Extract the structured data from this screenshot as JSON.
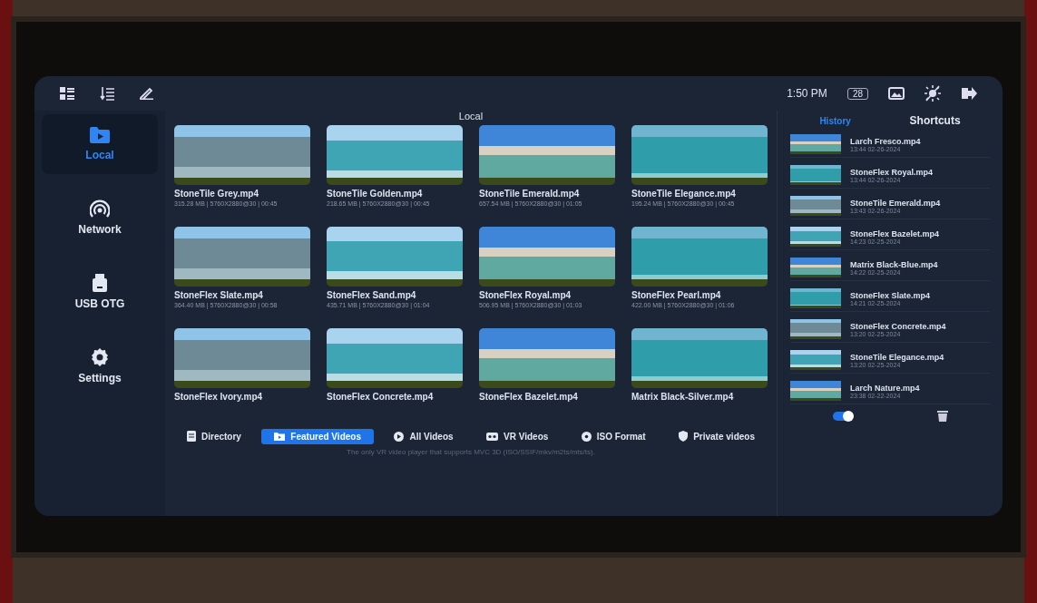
{
  "toolbar": {
    "time": "1:50 PM",
    "battery": "28"
  },
  "sidebar": {
    "items": [
      {
        "label": "Local",
        "kind": "folder",
        "selected": true
      },
      {
        "label": "Network",
        "kind": "network",
        "selected": false
      },
      {
        "label": "USB OTG",
        "kind": "usb",
        "selected": false
      },
      {
        "label": "Settings",
        "kind": "settings",
        "selected": false
      }
    ]
  },
  "main": {
    "title": "Local",
    "videos": [
      {
        "name": "StoneTile Grey.mp4",
        "meta": "315.28 MB | 5760X2880@30 | 00:45"
      },
      {
        "name": "StoneTile Golden.mp4",
        "meta": "218.65 MB | 5760X2880@30 | 00:45"
      },
      {
        "name": "StoneTile Emerald.mp4",
        "meta": "657.54 MB | 5760X2880@30 | 01:05"
      },
      {
        "name": "StoneTile Elegance.mp4",
        "meta": "195.24 MB | 5760X2880@30 | 00:45"
      },
      {
        "name": "StoneFlex Slate.mp4",
        "meta": "364.40 MB | 5760X2880@30 | 00:58"
      },
      {
        "name": "StoneFlex Sand.mp4",
        "meta": "435.71 MB | 5760X2880@30 | 01:04"
      },
      {
        "name": "StoneFlex Royal.mp4",
        "meta": "506.95 MB | 5760X2880@30 | 01:03"
      },
      {
        "name": "StoneFlex Pearl.mp4",
        "meta": "422.00 MB | 5760X2880@30 | 01:06"
      },
      {
        "name": "StoneFlex Ivory.mp4"
      },
      {
        "name": "StoneFlex Concrete.mp4"
      },
      {
        "name": "StoneFlex Bazelet.mp4"
      },
      {
        "name": "Matrix Black-Silver.mp4"
      }
    ],
    "tabs": [
      {
        "label": "Directory",
        "kind": "directory",
        "selected": false
      },
      {
        "label": "Featured Videos",
        "kind": "featured",
        "selected": true
      },
      {
        "label": "All Videos",
        "kind": "all",
        "selected": false
      },
      {
        "label": "VR Videos",
        "kind": "vr",
        "selected": false
      },
      {
        "label": "ISO Format",
        "kind": "iso",
        "selected": false
      },
      {
        "label": "Private videos",
        "kind": "private",
        "selected": false
      }
    ],
    "footer": "The only VR video player that supports MVC 3D (ISO/SSIF/mkv/m2ts/mts/ts)."
  },
  "history": {
    "tabs": [
      {
        "label": "History",
        "selected": true
      },
      {
        "label": "Shortcuts",
        "selected": false
      }
    ],
    "items": [
      {
        "name": "Larch Fresco.mp4",
        "time": "13:44 02-26-2024"
      },
      {
        "name": "StoneFlex Royal.mp4",
        "time": "13:44 02-26-2024"
      },
      {
        "name": "StoneTile Emerald.mp4",
        "time": "13:43 02-26-2024"
      },
      {
        "name": "StoneFlex Bazelet.mp4",
        "time": "14:23 02-25-2024"
      },
      {
        "name": "Matrix Black-Blue.mp4",
        "time": "14:22 02-25-2024"
      },
      {
        "name": "StoneFlex Slate.mp4",
        "time": "14:21 02-25-2024"
      },
      {
        "name": "StoneFlex Concrete.mp4",
        "time": "13:20 02-25-2024"
      },
      {
        "name": "StoneTile Elegance.mp4",
        "time": "13:20 02-25-2024"
      },
      {
        "name": "Larch Nature.mp4",
        "time": "23:38 02-22-2024"
      }
    ],
    "toggle": {
      "on": true
    }
  }
}
